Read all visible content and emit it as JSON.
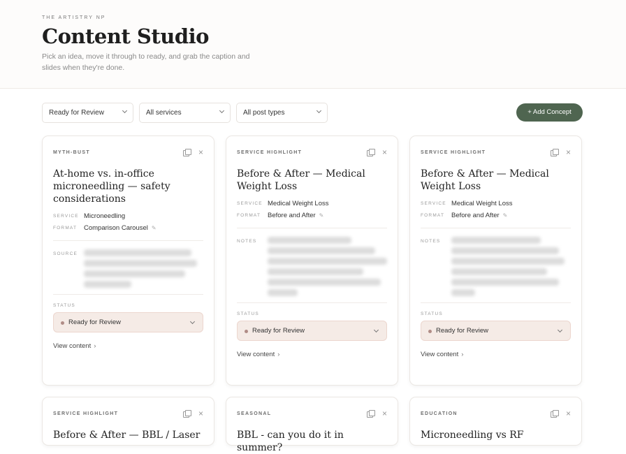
{
  "header": {
    "brand": "THE ARTISTRY NP",
    "title": "Content Studio",
    "subtitle": "Pick an idea, move it through to ready, and grab the caption and slides when they're done."
  },
  "filters": {
    "status": "Ready for Review",
    "services": "All services",
    "post_types": "All post types",
    "add_label": "+ Add Concept"
  },
  "labels": {
    "service": "SERVICE",
    "format": "FORMAT",
    "source": "SOURCE",
    "notes": "NOTES",
    "status": "STATUS",
    "view": "View content"
  },
  "cards": [
    {
      "type": "MYTH-BUST",
      "title": "At-home vs. in-office microneedling — safety considerations",
      "service": "Microneedling",
      "format": "Comparison Carousel",
      "status": "Ready for Review"
    },
    {
      "type": "SERVICE HIGHLIGHT",
      "title": "Before & After — Medical Weight Loss",
      "service": "Medical Weight Loss",
      "format": "Before and After",
      "status": "Ready for Review"
    },
    {
      "type": "SERVICE HIGHLIGHT",
      "title": "Before & After — Medical Weight Loss",
      "service": "Medical Weight Loss",
      "format": "Before and After",
      "status": "Ready for Review"
    },
    {
      "type": "SERVICE HIGHLIGHT",
      "title": "Before & After — BBL / Laser"
    },
    {
      "type": "SEASONAL",
      "title": "BBL - can you do it in summer?"
    },
    {
      "type": "EDUCATION",
      "title": "Microneedling vs RF"
    }
  ],
  "colors": {
    "accent": "#4f6550",
    "status_bg": "#f5ebe6",
    "status_dot": "#b08c86"
  }
}
